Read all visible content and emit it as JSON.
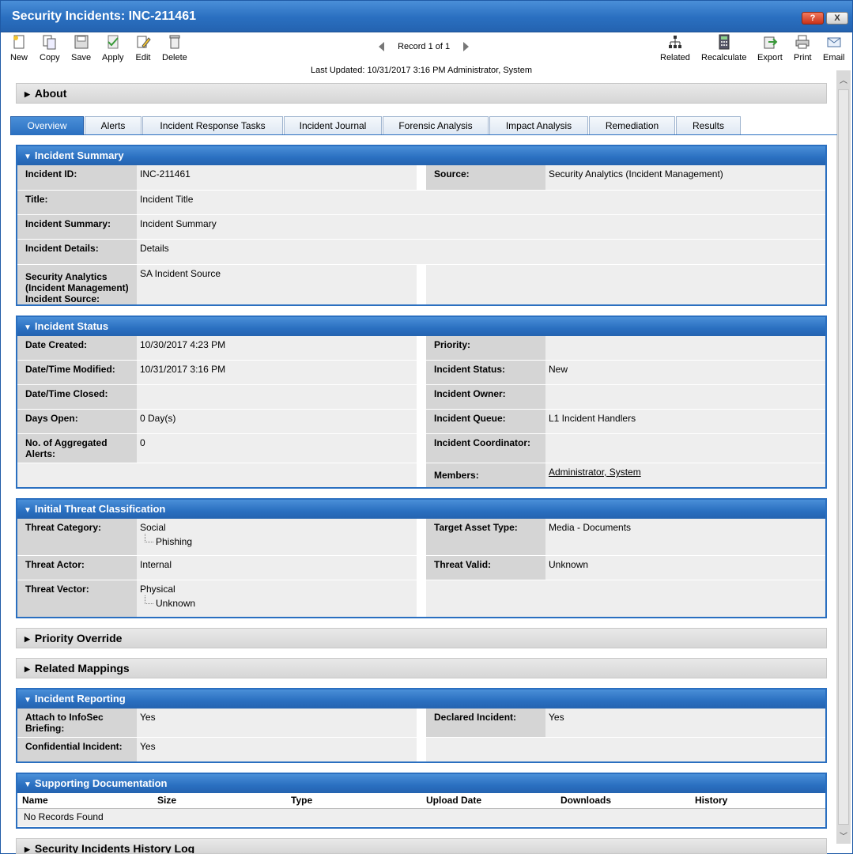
{
  "window": {
    "title": "Security Incidents: INC-211461",
    "help": "?",
    "close": "X"
  },
  "toolbar": {
    "left": [
      {
        "label": "New",
        "icon": "new-icon"
      },
      {
        "label": "Copy",
        "icon": "copy-icon"
      },
      {
        "label": "Save",
        "icon": "save-icon"
      },
      {
        "label": "Apply",
        "icon": "apply-icon"
      },
      {
        "label": "Edit",
        "icon": "edit-icon"
      },
      {
        "label": "Delete",
        "icon": "delete-icon"
      }
    ],
    "record": "Record 1 of 1",
    "right": [
      {
        "label": "Related",
        "icon": "related-icon"
      },
      {
        "label": "Recalculate",
        "icon": "calculator-icon"
      },
      {
        "label": "Export",
        "icon": "export-icon"
      },
      {
        "label": "Print",
        "icon": "print-icon"
      },
      {
        "label": "Email",
        "icon": "email-icon"
      }
    ]
  },
  "last_updated": "Last Updated: 10/31/2017 3:16 PM Administrator, System",
  "about": "About",
  "tabs": [
    "Overview",
    "Alerts",
    "Incident Response Tasks",
    "Incident Journal",
    "Forensic Analysis",
    "Impact Analysis",
    "Remediation",
    "Results"
  ],
  "summary": {
    "title": "Incident Summary",
    "incident_id_label": "Incident ID:",
    "incident_id": "INC-211461",
    "source_label": "Source:",
    "source": "Security Analytics (Incident Management)",
    "title_label": "Title:",
    "title_value": "Incident Title",
    "summary_label": "Incident Summary:",
    "summary_value": "Incident Summary",
    "details_label": "Incident Details:",
    "details_value": "Details",
    "sa_label": "Security Analytics (Incident Management) Incident Source:",
    "sa_value": "SA Incident Source"
  },
  "status": {
    "title": "Incident Status",
    "date_created_label": "Date Created:",
    "date_created": "10/30/2017 4:23 PM",
    "priority_label": "Priority:",
    "priority": "",
    "modified_label": "Date/Time Modified:",
    "modified": "10/31/2017 3:16 PM",
    "status_label": "Incident Status:",
    "status_value": "New",
    "closed_label": "Date/Time Closed:",
    "closed": "",
    "owner_label": "Incident Owner:",
    "owner": "",
    "days_label": "Days Open:",
    "days": "0 Day(s)",
    "queue_label": "Incident Queue:",
    "queue": "L1 Incident Handlers",
    "alerts_label": "No. of Aggregated Alerts:",
    "alerts": "0",
    "coordinator_label": "Incident Coordinator:",
    "coordinator": "",
    "members_label": "Members:",
    "members": "Administrator, System"
  },
  "threat": {
    "title": "Initial Threat Classification",
    "category_label": "Threat Category:",
    "category": "Social",
    "category_sub": "Phishing",
    "asset_label": "Target Asset Type:",
    "asset": "Media - Documents",
    "actor_label": "Threat Actor:",
    "actor": "Internal",
    "valid_label": "Threat Valid:",
    "valid": "Unknown",
    "vector_label": "Threat Vector:",
    "vector": "Physical",
    "vector_sub": "Unknown"
  },
  "priority_override": "Priority Override",
  "related_mappings": "Related Mappings",
  "reporting": {
    "title": "Incident Reporting",
    "attach_label": "Attach to InfoSec Briefing:",
    "attach": "Yes",
    "declared_label": "Declared Incident:",
    "declared": "Yes",
    "confidential_label": "Confidential Incident:",
    "confidential": "Yes"
  },
  "docs": {
    "title": "Supporting Documentation",
    "columns": [
      "Name",
      "Size",
      "Type",
      "Upload Date",
      "Downloads",
      "History"
    ],
    "empty": "No Records Found"
  },
  "history_log": "Security Incidents History Log"
}
